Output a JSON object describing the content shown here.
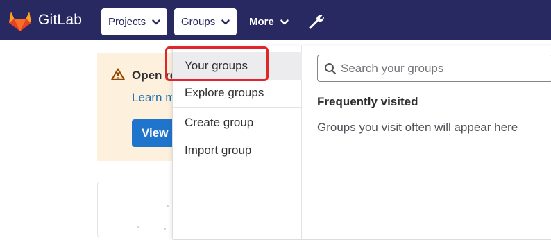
{
  "header": {
    "brand": "GitLab",
    "projects_label": "Projects",
    "groups_label": "Groups",
    "more_label": "More"
  },
  "background": {
    "alert_title": "Open re",
    "alert_link": "Learn m",
    "alert_button": "View s"
  },
  "groups_menu": {
    "items": [
      {
        "label": "Your groups",
        "active": true
      },
      {
        "label": "Explore groups"
      },
      {
        "label": "Create group"
      },
      {
        "label": "Import group"
      }
    ],
    "search_placeholder": "Search your groups",
    "frequently_visited_title": "Frequently visited",
    "frequently_visited_empty": "Groups you visit often will appear here"
  },
  "colors": {
    "navbar": "#292961",
    "highlight": "#e0262a",
    "alert_bg": "#fdf1dd",
    "button_blue": "#1f75cb"
  }
}
